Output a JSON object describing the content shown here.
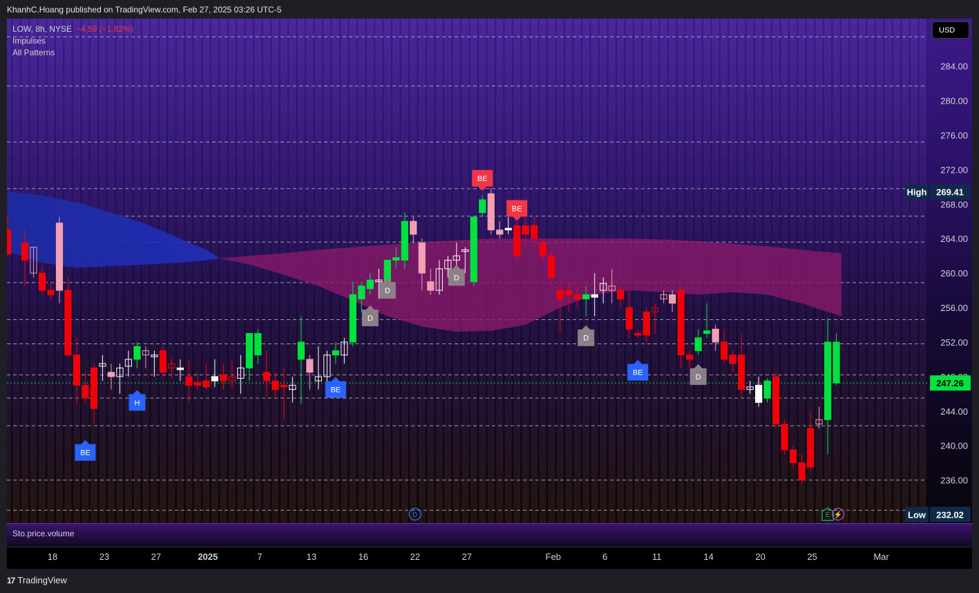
{
  "header": {
    "publisher_line": "KhanhC.Hoang published on TradingView.com, Feb 27, 2025 03:26 UTC-5"
  },
  "legend": {
    "symbol": "LOW, 8h, NYSE",
    "change": "−4.59 (−1.82%)",
    "indicators": [
      "Impulses",
      "All Patterns"
    ]
  },
  "currency_button": "USD",
  "lower_pane_label": "Sto.price.volume",
  "footer": {
    "logo_text": "TradingView",
    "logo_mark": "17"
  },
  "colors": {
    "up": "#00e33f",
    "down": "#f2000a",
    "neutral": "#ffffff",
    "pink": "#f0a0b0",
    "bear_marker": "#f23645",
    "bull_marker": "#2962ff",
    "pattern_marker": "#8d7f88",
    "cloud_blue": "#1d2aa0",
    "cloud_magenta": "#8b1a6a",
    "background_top": "#3c1a8a"
  },
  "chart_data": {
    "type": "candlestick",
    "symbol": "LOW",
    "interval": "8h",
    "exchange": "NYSE",
    "currency": "USD",
    "ylim": [
      231,
      289.5
    ],
    "yticks": [
      236,
      240,
      244,
      248,
      252,
      256,
      260,
      264,
      268,
      272,
      276,
      280,
      284
    ],
    "ytick_labels": [
      "236.00",
      "240.00",
      "244.00",
      "248.00",
      "252.00",
      "256.00",
      "260.00",
      "264.00",
      "268.00",
      "272.00",
      "276.00",
      "280.00",
      "284.00"
    ],
    "xlim": [
      0,
      53.3
    ],
    "xticks": [
      {
        "x": 2.6,
        "label": "18",
        "bold": false
      },
      {
        "x": 5.6,
        "label": "23",
        "bold": false
      },
      {
        "x": 8.6,
        "label": "27",
        "bold": false
      },
      {
        "x": 11.6,
        "label": "2025",
        "bold": true
      },
      {
        "x": 14.6,
        "label": "7",
        "bold": false
      },
      {
        "x": 17.6,
        "label": "13",
        "bold": false
      },
      {
        "x": 20.6,
        "label": "16",
        "bold": false
      },
      {
        "x": 23.6,
        "label": "22",
        "bold": false
      },
      {
        "x": 26.6,
        "label": "27",
        "bold": false
      },
      {
        "x": 31.6,
        "label": "Feb",
        "bold": false
      },
      {
        "x": 34.6,
        "label": "6",
        "bold": false
      },
      {
        "x": 37.6,
        "label": "11",
        "bold": false
      },
      {
        "x": 40.6,
        "label": "14",
        "bold": false
      },
      {
        "x": 43.6,
        "label": "20",
        "bold": false
      },
      {
        "x": 46.6,
        "label": "25",
        "bold": false
      },
      {
        "x": 50.6,
        "label": "Mar",
        "bold": false
      }
    ],
    "candles": [
      {
        "x": 0.0,
        "o": 265.0,
        "h": 266.5,
        "l": 262.0,
        "c": 262.2,
        "k": "down"
      },
      {
        "x": 1.0,
        "o": 263.5,
        "h": 265.0,
        "l": 258.5,
        "c": 261.5,
        "k": "down"
      },
      {
        "x": 1.5,
        "o": 260.0,
        "h": 263.0,
        "l": 259.5,
        "c": 263.0,
        "k": "pink"
      },
      {
        "x": 2.0,
        "o": 260.0,
        "h": 260.8,
        "l": 257.5,
        "c": 258.0,
        "k": "down"
      },
      {
        "x": 2.5,
        "o": 258.0,
        "h": 259.0,
        "l": 257.0,
        "c": 257.5,
        "k": "down"
      },
      {
        "x": 3.0,
        "o": 265.8,
        "h": 266.5,
        "l": 256.5,
        "c": 258.0,
        "k": "pink"
      },
      {
        "x": 3.5,
        "o": 258.0,
        "h": 259.5,
        "l": 251.5,
        "c": 250.5,
        "k": "down"
      },
      {
        "x": 4.0,
        "o": 250.5,
        "h": 252.5,
        "l": 244.8,
        "c": 247.0,
        "k": "down"
      },
      {
        "x": 4.5,
        "o": 247.0,
        "h": 248.5,
        "l": 245.0,
        "c": 245.5,
        "k": "down"
      },
      {
        "x": 5.0,
        "o": 249.0,
        "h": 249.5,
        "l": 242.5,
        "c": 244.3,
        "k": "down"
      },
      {
        "x": 5.5,
        "o": 249.2,
        "h": 250.5,
        "l": 247.5,
        "c": 249.5,
        "k": "neutral"
      },
      {
        "x": 6.0,
        "o": 248.5,
        "h": 249.5,
        "l": 246.5,
        "c": 248.0,
        "k": "pink"
      },
      {
        "x": 6.5,
        "o": 248.0,
        "h": 249.5,
        "l": 246.0,
        "c": 249.0,
        "k": "neutral"
      },
      {
        "x": 7.0,
        "o": 249.2,
        "h": 251.0,
        "l": 248.0,
        "c": 250.0,
        "k": "neutral"
      },
      {
        "x": 7.5,
        "o": 250.0,
        "h": 252.0,
        "l": 249.0,
        "c": 251.5,
        "k": "up"
      },
      {
        "x": 8.0,
        "o": 250.5,
        "h": 251.5,
        "l": 249.0,
        "c": 251.0,
        "k": "pink"
      },
      {
        "x": 8.5,
        "o": 250.3,
        "h": 251.0,
        "l": 248.0,
        "c": 250.5,
        "k": "neutral"
      },
      {
        "x": 9.0,
        "o": 251.0,
        "h": 251.5,
        "l": 248.0,
        "c": 248.5,
        "k": "down"
      },
      {
        "x": 9.5,
        "o": 249.0,
        "h": 250.2,
        "l": 247.8,
        "c": 249.5,
        "k": "down"
      },
      {
        "x": 10.0,
        "o": 249.0,
        "h": 250.0,
        "l": 247.5,
        "c": 248.8,
        "k": "neutral"
      },
      {
        "x": 10.5,
        "o": 248.0,
        "h": 249.8,
        "l": 245.0,
        "c": 247.0,
        "k": "down"
      },
      {
        "x": 11.0,
        "o": 247.3,
        "h": 248.5,
        "l": 246.5,
        "c": 247.0,
        "k": "down"
      },
      {
        "x": 11.5,
        "o": 247.5,
        "h": 249.5,
        "l": 246.5,
        "c": 246.8,
        "k": "down"
      },
      {
        "x": 12.0,
        "o": 248.0,
        "h": 250.0,
        "l": 246.8,
        "c": 247.5,
        "k": "neutral"
      },
      {
        "x": 12.5,
        "o": 248.2,
        "h": 249.5,
        "l": 246.5,
        "c": 247.5,
        "k": "down"
      },
      {
        "x": 13.0,
        "o": 247.5,
        "h": 249.8,
        "l": 246.5,
        "c": 248.0,
        "k": "down"
      },
      {
        "x": 13.5,
        "o": 247.8,
        "h": 250.5,
        "l": 246.0,
        "c": 249.0,
        "k": "neutral"
      },
      {
        "x": 14.0,
        "o": 249.0,
        "h": 253.0,
        "l": 247.5,
        "c": 253.0,
        "k": "up"
      },
      {
        "x": 14.5,
        "o": 253.0,
        "h": 253.5,
        "l": 249.5,
        "c": 250.5,
        "k": "up"
      },
      {
        "x": 15.0,
        "o": 248.5,
        "h": 251.0,
        "l": 245.5,
        "c": 247.5,
        "k": "down"
      },
      {
        "x": 15.5,
        "o": 247.5,
        "h": 248.5,
        "l": 245.5,
        "c": 246.5,
        "k": "down"
      },
      {
        "x": 16.0,
        "o": 247.0,
        "h": 249.0,
        "l": 243.0,
        "c": 246.8,
        "k": "down"
      },
      {
        "x": 16.5,
        "o": 246.5,
        "h": 248.0,
        "l": 245.0,
        "c": 247.0,
        "k": "neutral"
      },
      {
        "x": 17.0,
        "o": 250.0,
        "h": 255.0,
        "l": 244.8,
        "c": 252.0,
        "k": "up"
      },
      {
        "x": 17.5,
        "o": 250.0,
        "h": 250.5,
        "l": 246.5,
        "c": 248.5,
        "k": "pink"
      },
      {
        "x": 18.0,
        "o": 247.5,
        "h": 251.5,
        "l": 246.5,
        "c": 248.0,
        "k": "neutral"
      },
      {
        "x": 18.5,
        "o": 248.0,
        "h": 251.0,
        "l": 246.0,
        "c": 250.5,
        "k": "neutral"
      },
      {
        "x": 19.0,
        "o": 250.5,
        "h": 252.0,
        "l": 249.5,
        "c": 251.0,
        "k": "up"
      },
      {
        "x": 19.5,
        "o": 250.5,
        "h": 252.5,
        "l": 249.5,
        "c": 252.0,
        "k": "neutral"
      },
      {
        "x": 20.0,
        "o": 252.0,
        "h": 259.0,
        "l": 251.5,
        "c": 257.5,
        "k": "up"
      },
      {
        "x": 20.5,
        "o": 257.0,
        "h": 259.0,
        "l": 255.5,
        "c": 258.5,
        "k": "up"
      },
      {
        "x": 21.0,
        "o": 258.2,
        "h": 260.0,
        "l": 257.5,
        "c": 259.2,
        "k": "up"
      },
      {
        "x": 21.5,
        "o": 259.0,
        "h": 260.5,
        "l": 257.0,
        "c": 259.2,
        "k": "neutral"
      },
      {
        "x": 22.0,
        "o": 258.5,
        "h": 261.5,
        "l": 258.0,
        "c": 261.5,
        "k": "up"
      },
      {
        "x": 22.5,
        "o": 261.5,
        "h": 263.0,
        "l": 260.5,
        "c": 261.8,
        "k": "up"
      },
      {
        "x": 23.0,
        "o": 261.5,
        "h": 267.0,
        "l": 260.5,
        "c": 266.0,
        "k": "up"
      },
      {
        "x": 23.5,
        "o": 266.0,
        "h": 266.5,
        "l": 263.5,
        "c": 264.5,
        "k": "pink"
      },
      {
        "x": 24.0,
        "o": 263.5,
        "h": 264.0,
        "l": 258.0,
        "c": 260.0,
        "k": "pink"
      },
      {
        "x": 24.5,
        "o": 259.0,
        "h": 260.5,
        "l": 257.5,
        "c": 258.0,
        "k": "pink"
      },
      {
        "x": 25.0,
        "o": 258.0,
        "h": 261.5,
        "l": 257.5,
        "c": 260.5,
        "k": "neutral"
      },
      {
        "x": 25.5,
        "o": 260.5,
        "h": 262.0,
        "l": 259.5,
        "c": 261.5,
        "k": "neutral"
      },
      {
        "x": 26.0,
        "o": 261.5,
        "h": 263.5,
        "l": 260.5,
        "c": 262.0,
        "k": "neutral"
      },
      {
        "x": 26.5,
        "o": 262.5,
        "h": 263.0,
        "l": 260.0,
        "c": 262.7,
        "k": "neutral"
      },
      {
        "x": 27.0,
        "o": 259.0,
        "h": 266.5,
        "l": 258.5,
        "c": 266.5,
        "k": "up"
      },
      {
        "x": 27.5,
        "o": 267.0,
        "h": 269.0,
        "l": 266.5,
        "c": 268.5,
        "k": "up"
      },
      {
        "x": 28.0,
        "o": 269.2,
        "h": 269.8,
        "l": 264.5,
        "c": 265.0,
        "k": "pink"
      },
      {
        "x": 28.5,
        "o": 265.0,
        "h": 266.0,
        "l": 264.0,
        "c": 264.5,
        "k": "pink"
      },
      {
        "x": 29.0,
        "o": 265.2,
        "h": 266.5,
        "l": 264.5,
        "c": 265.0,
        "k": "neutral"
      },
      {
        "x": 29.5,
        "o": 265.5,
        "h": 266.0,
        "l": 261.5,
        "c": 262.0,
        "k": "down"
      },
      {
        "x": 30.0,
        "o": 265.5,
        "h": 266.5,
        "l": 263.0,
        "c": 264.5,
        "k": "down"
      },
      {
        "x": 30.5,
        "o": 265.5,
        "h": 266.5,
        "l": 263.0,
        "c": 264.0,
        "k": "down"
      },
      {
        "x": 31.0,
        "o": 263.5,
        "h": 264.0,
        "l": 261.5,
        "c": 262.0,
        "k": "down"
      },
      {
        "x": 31.5,
        "o": 262.0,
        "h": 262.5,
        "l": 258.5,
        "c": 259.5,
        "k": "down"
      },
      {
        "x": 32.0,
        "o": 258.0,
        "h": 259.0,
        "l": 253.0,
        "c": 257.0,
        "k": "down"
      },
      {
        "x": 32.5,
        "o": 258.0,
        "h": 259.0,
        "l": 255.5,
        "c": 257.5,
        "k": "down"
      },
      {
        "x": 33.0,
        "o": 257.5,
        "h": 258.5,
        "l": 256.0,
        "c": 257.0,
        "k": "down"
      },
      {
        "x": 33.5,
        "o": 257.0,
        "h": 258.5,
        "l": 255.0,
        "c": 257.5,
        "k": "up"
      },
      {
        "x": 34.0,
        "o": 257.5,
        "h": 260.0,
        "l": 255.0,
        "c": 257.2,
        "k": "neutral"
      },
      {
        "x": 34.5,
        "o": 258.0,
        "h": 259.5,
        "l": 256.5,
        "c": 258.8,
        "k": "neutral"
      },
      {
        "x": 35.0,
        "o": 258.0,
        "h": 260.5,
        "l": 256.5,
        "c": 258.5,
        "k": "pink"
      },
      {
        "x": 35.5,
        "o": 258.0,
        "h": 258.5,
        "l": 256.0,
        "c": 257.0,
        "k": "down"
      },
      {
        "x": 36.0,
        "o": 256.0,
        "h": 258.0,
        "l": 252.5,
        "c": 253.5,
        "k": "down"
      },
      {
        "x": 36.5,
        "o": 253.0,
        "h": 253.5,
        "l": 252.5,
        "c": 252.8,
        "k": "down"
      },
      {
        "x": 37.0,
        "o": 255.5,
        "h": 256.0,
        "l": 252.0,
        "c": 252.8,
        "k": "down"
      },
      {
        "x": 37.5,
        "o": 255.5,
        "h": 256.5,
        "l": 253.0,
        "c": 256.0,
        "k": "down"
      },
      {
        "x": 38.0,
        "o": 257.0,
        "h": 258.0,
        "l": 256.5,
        "c": 257.5,
        "k": "pink"
      },
      {
        "x": 38.5,
        "o": 257.5,
        "h": 258.0,
        "l": 255.5,
        "c": 256.5,
        "k": "pink"
      },
      {
        "x": 39.0,
        "o": 258.0,
        "h": 258.5,
        "l": 249.0,
        "c": 250.5,
        "k": "down"
      },
      {
        "x": 39.5,
        "o": 250.5,
        "h": 251.0,
        "l": 249.0,
        "c": 250.0,
        "k": "down"
      },
      {
        "x": 40.0,
        "o": 251.0,
        "h": 253.5,
        "l": 250.5,
        "c": 252.5,
        "k": "up"
      },
      {
        "x": 40.5,
        "o": 253.0,
        "h": 256.5,
        "l": 252.5,
        "c": 253.3,
        "k": "up"
      },
      {
        "x": 41.0,
        "o": 253.5,
        "h": 254.0,
        "l": 251.0,
        "c": 252.0,
        "k": "pink"
      },
      {
        "x": 41.5,
        "o": 252.0,
        "h": 253.5,
        "l": 249.5,
        "c": 250.0,
        "k": "down"
      },
      {
        "x": 42.0,
        "o": 250.5,
        "h": 251.0,
        "l": 248.5,
        "c": 249.5,
        "k": "down"
      },
      {
        "x": 42.5,
        "o": 250.5,
        "h": 253.0,
        "l": 245.5,
        "c": 246.5,
        "k": "down"
      },
      {
        "x": 43.0,
        "o": 246.5,
        "h": 247.5,
        "l": 246.0,
        "c": 246.8,
        "k": "neutral"
      },
      {
        "x": 43.5,
        "o": 247.0,
        "h": 248.0,
        "l": 244.5,
        "c": 245.0,
        "k": "neutral"
      },
      {
        "x": 44.0,
        "o": 245.5,
        "h": 247.8,
        "l": 245.0,
        "c": 247.5,
        "k": "up"
      },
      {
        "x": 44.5,
        "o": 248.0,
        "h": 248.5,
        "l": 242.0,
        "c": 242.5,
        "k": "down"
      },
      {
        "x": 45.0,
        "o": 242.5,
        "h": 243.0,
        "l": 239.0,
        "c": 239.5,
        "k": "down"
      },
      {
        "x": 45.5,
        "o": 239.5,
        "h": 240.0,
        "l": 237.5,
        "c": 238.0,
        "k": "down"
      },
      {
        "x": 46.0,
        "o": 238.0,
        "h": 239.0,
        "l": 235.5,
        "c": 236.0,
        "k": "down"
      },
      {
        "x": 46.5,
        "o": 242.0,
        "h": 244.0,
        "l": 237.0,
        "c": 237.5,
        "k": "down"
      },
      {
        "x": 47.0,
        "o": 242.5,
        "h": 244.5,
        "l": 242.0,
        "c": 243.0,
        "k": "pink"
      },
      {
        "x": 47.5,
        "o": 243.0,
        "h": 254.8,
        "l": 239.0,
        "c": 252.0,
        "k": "up"
      },
      {
        "x": 48.0,
        "o": 252.0,
        "h": 253.0,
        "l": 247.0,
        "c": 247.26,
        "k": "up"
      }
    ],
    "last_price": 247.26,
    "high": {
      "label": "High",
      "value": 269.41
    },
    "low": {
      "label": "Low",
      "value": 232.02
    },
    "last_price_label": "247.26",
    "high_label": "269.41",
    "low_label": "232.02",
    "markers": [
      {
        "x": 4.5,
        "price": 239.2,
        "text": "BE",
        "kind": "bull"
      },
      {
        "x": 7.5,
        "price": 245.0,
        "text": "H",
        "kind": "bull"
      },
      {
        "x": 19.0,
        "price": 246.5,
        "text": "BE",
        "kind": "bull"
      },
      {
        "x": 21.0,
        "price": 254.8,
        "text": "D",
        "kind": "pattern"
      },
      {
        "x": 22.0,
        "price": 258.0,
        "text": "D",
        "kind": "pattern"
      },
      {
        "x": 26.0,
        "price": 259.5,
        "text": "D",
        "kind": "pattern"
      },
      {
        "x": 27.5,
        "price": 271.0,
        "text": "BE",
        "kind": "bear"
      },
      {
        "x": 29.5,
        "price": 267.5,
        "text": "BE",
        "kind": "bear"
      },
      {
        "x": 33.5,
        "price": 252.5,
        "text": "D",
        "kind": "pattern"
      },
      {
        "x": 36.5,
        "price": 248.5,
        "text": "BE",
        "kind": "bull"
      },
      {
        "x": 40.0,
        "price": 248.0,
        "text": "D",
        "kind": "pattern"
      }
    ],
    "event_markers": [
      {
        "x": 23.6,
        "text": "D",
        "kind": "dividend"
      },
      {
        "x": 47.5,
        "text": "E",
        "kind": "earnings"
      },
      {
        "x": 48.1,
        "text": "⚡",
        "kind": "split"
      }
    ],
    "horizontal_levels": [
      232.5,
      236.0,
      242.3,
      245.5,
      248.2,
      251.8,
      254.6,
      258.9,
      263.6,
      266.6,
      269.8,
      275.2,
      281.7,
      287.4
    ],
    "cloud_blue": {
      "x": [
        0.0,
        2.0,
        4.0,
        6.0,
        8.0,
        10.0,
        11.5,
        12.3
      ],
      "upper": [
        269.5,
        269.0,
        268.2,
        267.0,
        265.7,
        264.0,
        262.7,
        261.7
      ],
      "lower": [
        262.5,
        261.2,
        260.6,
        260.8,
        261.0,
        261.2,
        261.5,
        261.7
      ]
    },
    "cloud_magenta": {
      "x": [
        12.3,
        14.0,
        16.0,
        18.0,
        20.0,
        22.0,
        24.0,
        26.0,
        28.0,
        30.0,
        32.0,
        34.0,
        36.0,
        38.0,
        40.0,
        42.0,
        44.0,
        46.0,
        47.0,
        48.3
      ],
      "upper": [
        261.7,
        262.0,
        262.3,
        262.7,
        263.0,
        263.3,
        263.6,
        263.8,
        264.0,
        264.0,
        264.0,
        264.0,
        264.0,
        263.9,
        263.7,
        263.4,
        263.1,
        262.7,
        262.5,
        262.3
      ],
      "lower": [
        261.7,
        261.0,
        259.8,
        258.5,
        256.8,
        255.0,
        253.8,
        253.2,
        253.3,
        254.0,
        256.0,
        257.5,
        258.0,
        257.8,
        257.5,
        257.8,
        257.5,
        256.5,
        255.8,
        255.0
      ]
    }
  }
}
